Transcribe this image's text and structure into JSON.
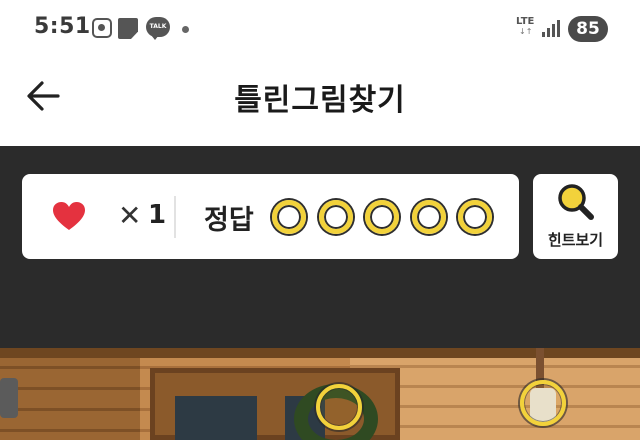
{
  "status_bar": {
    "time": "5:51",
    "talk_label": "TALK",
    "network": "LTE",
    "network_arrows": "↓↑",
    "battery": "85"
  },
  "header": {
    "title": "틀린그림찾기",
    "back_icon": "arrow-left-icon"
  },
  "score": {
    "lives_icon": "heart-icon",
    "lives_multiplier": "✕",
    "lives": "1",
    "answer_label": "정답",
    "answers_total": 5,
    "answers_found": 0
  },
  "hint": {
    "icon": "magnifier-icon",
    "label": "힌트보기"
  },
  "photo": {
    "found_markers": 2
  },
  "colors": {
    "accent_yellow": "#f2d23b",
    "heart_red": "#e4323f",
    "game_background": "#2b2b2b"
  }
}
